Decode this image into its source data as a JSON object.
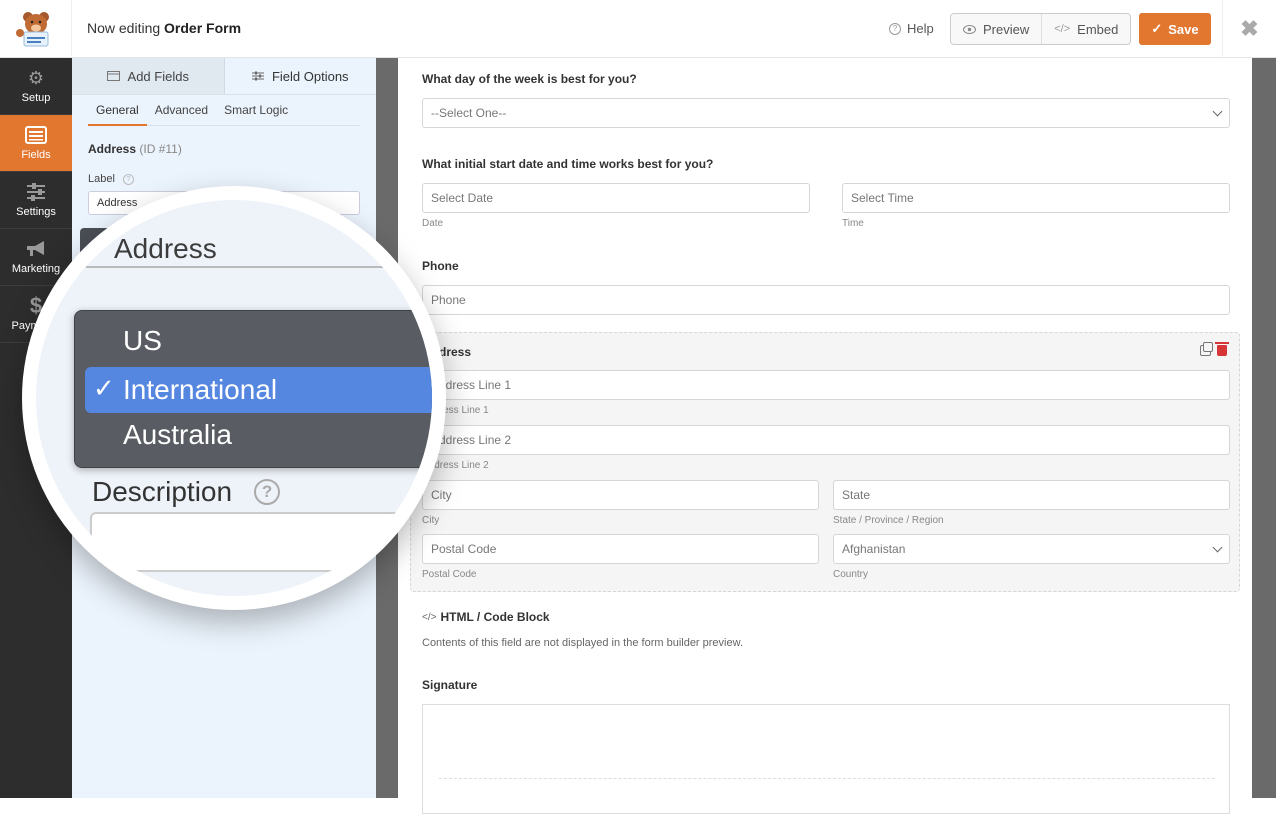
{
  "header": {
    "title_prefix": "Now editing",
    "form_name": "Order Form",
    "help_label": "Help",
    "preview_label": "Preview",
    "embed_label": "Embed",
    "save_label": "Save",
    "close_icon": "close-icon",
    "accent_color": "#e27730"
  },
  "sidebar": {
    "items": [
      {
        "label": "Setup",
        "icon": "gear-icon"
      },
      {
        "label": "Fields",
        "icon": "fields-list-icon",
        "active": true
      },
      {
        "label": "Settings",
        "icon": "sliders-icon"
      },
      {
        "label": "Marketing",
        "icon": "megaphone-icon"
      },
      {
        "label": "Payments",
        "icon": "dollar-icon"
      }
    ]
  },
  "panel": {
    "tabs": [
      {
        "label": "Add Fields",
        "icon": "table-icon"
      },
      {
        "label": "Field Options",
        "icon": "sliders-icon",
        "active": true
      }
    ],
    "subtabs": [
      {
        "label": "General",
        "active": true
      },
      {
        "label": "Advanced"
      },
      {
        "label": "Smart Logic"
      }
    ],
    "field_name": "Address",
    "field_id": "(ID #11)",
    "label_caption": "Label",
    "label_value": "Address"
  },
  "magnifier": {
    "title": "Address",
    "scheme_options": [
      "US",
      "International",
      "Australia"
    ],
    "selected_option": "International",
    "description_label": "Description"
  },
  "form": {
    "day_question": "What day of the week is best for you?",
    "day_select": "--Select One--",
    "datetime_question": "What initial start date and time works best for you?",
    "date_placeholder": "Select Date",
    "date_sublabel": "Date",
    "time_placeholder": "Select Time",
    "time_sublabel": "Time",
    "phone_label": "Phone",
    "phone_placeholder": "Phone",
    "address": {
      "label": "Address",
      "line1_placeholder": "Address Line 1",
      "line1_sublabel": "Address Line 1",
      "line2_placeholder": "Address Line 2",
      "line2_sublabel": "Address Line 2",
      "city_placeholder": "City",
      "city_sublabel": "City",
      "state_placeholder": "State",
      "state_sublabel": "State / Province / Region",
      "postal_placeholder": "Postal Code",
      "postal_sublabel": "Postal Code",
      "country_value": "Afghanistan",
      "country_sublabel": "Country"
    },
    "html_block_title": "HTML / Code Block",
    "html_block_note": "Contents of this field are not displayed in the form builder preview.",
    "signature_label": "Signature"
  }
}
